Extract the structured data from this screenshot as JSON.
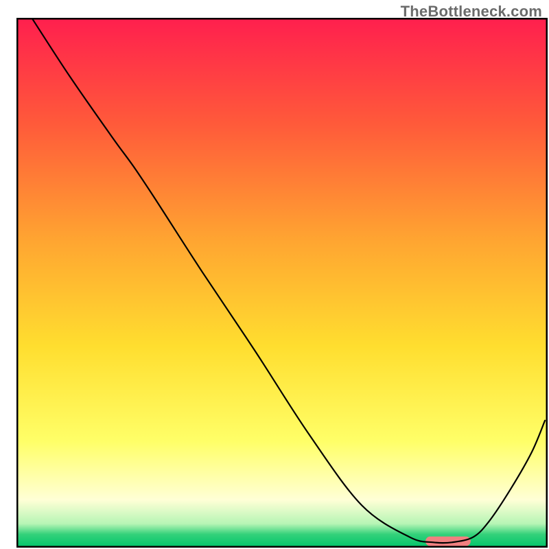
{
  "watermark": "TheBottleneck.com",
  "chart_data": {
    "type": "line",
    "title": "",
    "xlabel": "",
    "ylabel": "",
    "xlim": [
      0,
      100
    ],
    "ylim": [
      0,
      100
    ],
    "grid": false,
    "legend": false,
    "background_gradient": [
      {
        "offset": 0.0,
        "color": "#ff1f4e"
      },
      {
        "offset": 0.2,
        "color": "#ff5a3a"
      },
      {
        "offset": 0.42,
        "color": "#ffa531"
      },
      {
        "offset": 0.62,
        "color": "#ffde2f"
      },
      {
        "offset": 0.8,
        "color": "#ffff68"
      },
      {
        "offset": 0.91,
        "color": "#ffffd6"
      },
      {
        "offset": 0.955,
        "color": "#b6f5b5"
      },
      {
        "offset": 0.975,
        "color": "#33d17a"
      },
      {
        "offset": 1.0,
        "color": "#00c46b"
      }
    ],
    "series": [
      {
        "name": "bottleneck-curve",
        "stroke": "#000000",
        "stroke_width": 2.2,
        "x": [
          3.0,
          10.0,
          18.0,
          22.0,
          26.0,
          35.0,
          45.0,
          55.0,
          65.0,
          74.0,
          78.5,
          82.0,
          86.0,
          89.0,
          93.0,
          97.0,
          99.5
        ],
        "y": [
          99.8,
          89.0,
          77.5,
          72.0,
          66.0,
          52.0,
          37.0,
          21.5,
          8.0,
          2.0,
          1.0,
          1.0,
          2.0,
          5.0,
          11.0,
          18.0,
          24.0
        ]
      }
    ],
    "highlight_bar": {
      "name": "optimal-range",
      "color": "#f08080",
      "x_start": 77.0,
      "x_end": 85.5,
      "y_center": 1.2,
      "height": 1.8,
      "corner_radius_y": 0.9
    },
    "inner_border": {
      "color": "#000000",
      "width": 2.5
    }
  }
}
